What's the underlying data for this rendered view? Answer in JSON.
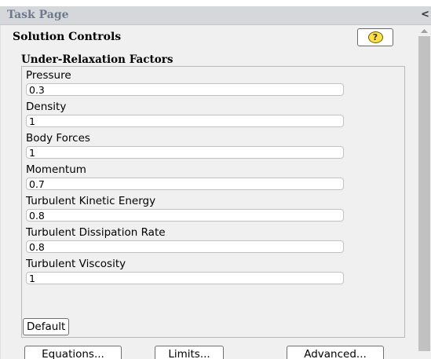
{
  "window": {
    "title": "Task Page",
    "collapse_glyph": "<"
  },
  "panel": {
    "title": "Solution Controls",
    "help_icon": "?",
    "group_title": "Under-Relaxation Factors",
    "fields": [
      {
        "label": "Pressure",
        "value": "0.3"
      },
      {
        "label": "Density",
        "value": "1"
      },
      {
        "label": "Body Forces",
        "value": "1"
      },
      {
        "label": "Momentum",
        "value": "0.7"
      },
      {
        "label": "Turbulent Kinetic Energy",
        "value": "0.8"
      },
      {
        "label": "Turbulent Dissipation Rate",
        "value": "0.8"
      },
      {
        "label": "Turbulent Viscosity",
        "value": "1"
      }
    ],
    "buttons": {
      "default": "Default",
      "equations": "Equations...",
      "limits": "Limits...",
      "advanced": "Advanced..."
    }
  },
  "colors": {
    "title_text": "#6d7a8b",
    "help_icon_fill": "#ffe047",
    "scroll_thumb": "#c1c1c1"
  }
}
